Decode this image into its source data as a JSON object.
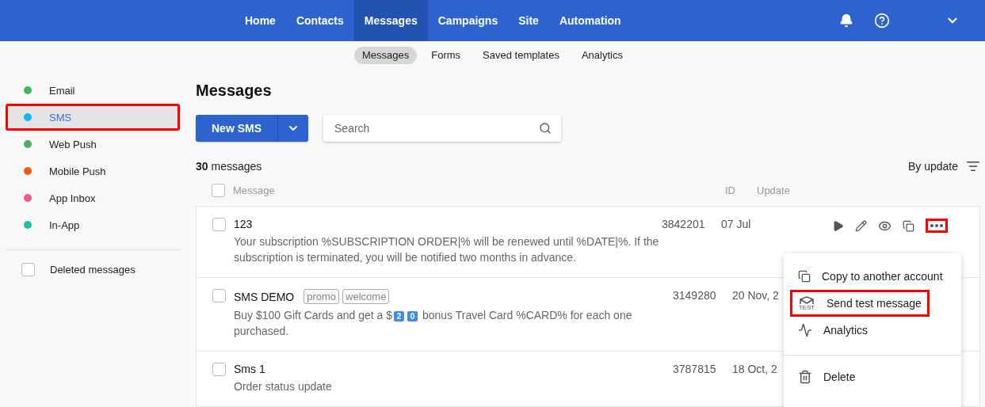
{
  "topnav": {
    "items": [
      {
        "label": "Home",
        "selected": false
      },
      {
        "label": "Contacts",
        "selected": false
      },
      {
        "label": "Messages",
        "selected": true
      },
      {
        "label": "Campaigns",
        "selected": false
      },
      {
        "label": "Site",
        "selected": false
      },
      {
        "label": "Automation",
        "selected": false
      }
    ]
  },
  "subnav": {
    "items": [
      {
        "label": "Messages",
        "selected": true
      },
      {
        "label": "Forms",
        "selected": false
      },
      {
        "label": "Saved templates",
        "selected": false
      },
      {
        "label": "Analytics",
        "selected": false
      }
    ]
  },
  "sidebar": {
    "items": [
      {
        "label": "Email",
        "color": "#3cba54",
        "selected": false,
        "highlighted": false
      },
      {
        "label": "SMS",
        "color": "#13b5f5",
        "selected": true,
        "highlighted": true
      },
      {
        "label": "Web Push",
        "color": "#4caf60",
        "selected": false,
        "highlighted": false
      },
      {
        "label": "Mobile Push",
        "color": "#f05a0a",
        "selected": false,
        "highlighted": false
      },
      {
        "label": "App Inbox",
        "color": "#f0578f",
        "selected": false,
        "highlighted": false
      },
      {
        "label": "In-App",
        "color": "#1fc0a5",
        "selected": false,
        "highlighted": false
      }
    ],
    "deleted": {
      "label": "Deleted messages",
      "checked": false
    }
  },
  "title": "Messages",
  "new_button": "New SMS",
  "search": {
    "placeholder": "Search"
  },
  "count": {
    "number": "30",
    "label": "messages"
  },
  "sort": "By update",
  "select_all": {
    "checked": false
  },
  "columns": {
    "message": "Message",
    "id": "ID",
    "update": "Update"
  },
  "rows": [
    {
      "title": "123",
      "tags": [],
      "checked": false,
      "id": "3842201",
      "update": "07 Jul",
      "actions_highlighted": true,
      "body": [
        {
          "kind": "text",
          "text": "Your subscription %SUBSCRIPTION ORDER|% will be renewed until %DATE|%. If the subscription is terminated, you will be notified two months in advance."
        }
      ]
    },
    {
      "title": "SMS DEMO",
      "tags": [
        "promo",
        "welcome"
      ],
      "checked": false,
      "id": "3149280",
      "update": "20 Nov, 2",
      "body": [
        {
          "kind": "text",
          "text": "Buy $100 Gift Cards and get a $"
        },
        {
          "kind": "key",
          "text": "2"
        },
        {
          "kind": "key",
          "text": "0"
        },
        {
          "kind": "text",
          "text": " bonus Travel Card %CARD% for each one purchased."
        }
      ]
    },
    {
      "title": "Sms 1",
      "tags": [],
      "checked": false,
      "id": "3787815",
      "update": "18 Oct, 2",
      "body": [
        {
          "kind": "text",
          "text": "Order status update"
        }
      ]
    }
  ],
  "menu": {
    "items": [
      {
        "kind": "copy",
        "label": "Copy to another account",
        "highlighted": false
      },
      {
        "kind": "test",
        "label": "Send test message",
        "highlighted": true,
        "icon_text": "TEST"
      },
      {
        "kind": "analytics",
        "label": "Analytics",
        "highlighted": false
      },
      {
        "kind": "delete",
        "label": "Delete",
        "highlighted": false
      }
    ]
  }
}
